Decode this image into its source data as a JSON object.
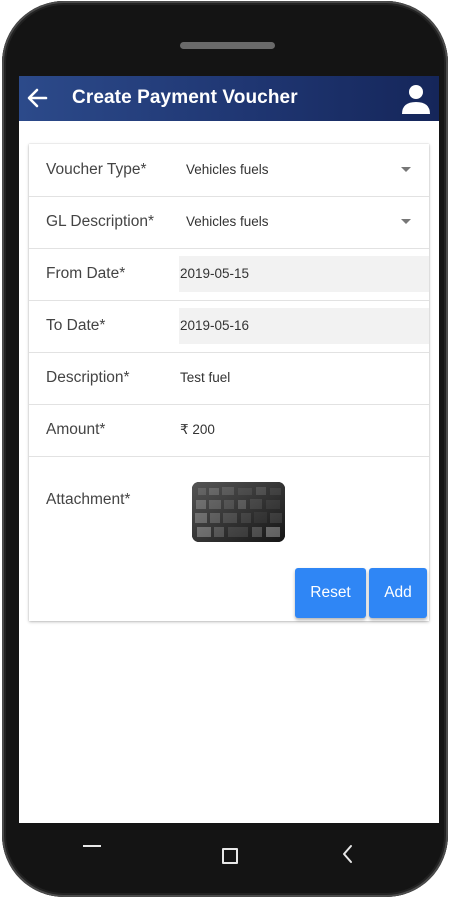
{
  "app": {
    "title": "Create Payment Voucher",
    "accent_color": "#2f86f5",
    "header_color": "#1f3672"
  },
  "icons": {
    "back": "back-arrow-icon",
    "user": "user-icon",
    "nav_menu": "nav-menu-icon",
    "nav_home": "nav-home-icon",
    "nav_back": "nav-back-icon"
  },
  "form": {
    "voucher_type": {
      "label": "Voucher Type*",
      "value": "Vehicles fuels"
    },
    "gl_description": {
      "label": "GL Description*",
      "value": "Vehicles fuels"
    },
    "from_date": {
      "label": "From Date*",
      "value": "2019-05-15"
    },
    "to_date": {
      "label": "To Date*",
      "value": "2019-05-16"
    },
    "description": {
      "label": "Description*",
      "value": "Test fuel"
    },
    "amount": {
      "label": "Amount*",
      "value": "₹ 200"
    },
    "attachment": {
      "label": "Attachment*"
    }
  },
  "buttons": {
    "reset_label": "Reset",
    "add_label": "Add"
  }
}
